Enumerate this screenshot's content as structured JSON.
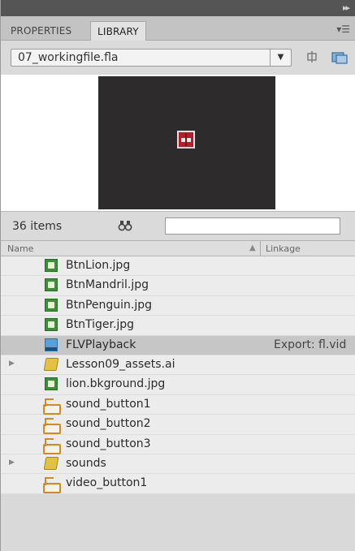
{
  "panel": {
    "tabs": [
      {
        "label": "PROPERTIES",
        "active": false
      },
      {
        "label": "LIBRARY",
        "active": true
      }
    ]
  },
  "library": {
    "file_selector": {
      "value": "07_workingfile.fla"
    },
    "item_count": "36 items",
    "search": {
      "value": ""
    },
    "columns": {
      "name": "Name",
      "linkage": "Linkage"
    },
    "items": [
      {
        "name": "BtnLion.jpg",
        "icon": "bitmap-icon",
        "linkage": ""
      },
      {
        "name": "BtnMandril.jpg",
        "icon": "bitmap-icon",
        "linkage": ""
      },
      {
        "name": "BtnPenguin.jpg",
        "icon": "bitmap-icon",
        "linkage": ""
      },
      {
        "name": "BtnTiger.jpg",
        "icon": "bitmap-icon",
        "linkage": ""
      },
      {
        "name": "FLVPlayback",
        "icon": "video-component-icon",
        "linkage": "Export: fl.vid",
        "selected": true
      },
      {
        "name": "Lesson09_assets.ai",
        "icon": "folder-icon",
        "linkage": "",
        "expandable": true
      },
      {
        "name": "lion.bkground.jpg",
        "icon": "bitmap-icon",
        "linkage": ""
      },
      {
        "name": "sound_button1",
        "icon": "button-symbol-icon",
        "linkage": ""
      },
      {
        "name": "sound_button2",
        "icon": "button-symbol-icon",
        "linkage": ""
      },
      {
        "name": "sound_button3",
        "icon": "button-symbol-icon",
        "linkage": ""
      },
      {
        "name": "sounds",
        "icon": "folder-icon",
        "linkage": "",
        "expandable": true
      },
      {
        "name": "video_button1",
        "icon": "button-symbol-icon",
        "linkage": ""
      }
    ]
  },
  "colors": {
    "panel_bg": "#d9d9d9",
    "preview_stage": "#2d2b2b",
    "selected_row": "#c6c6c6"
  }
}
